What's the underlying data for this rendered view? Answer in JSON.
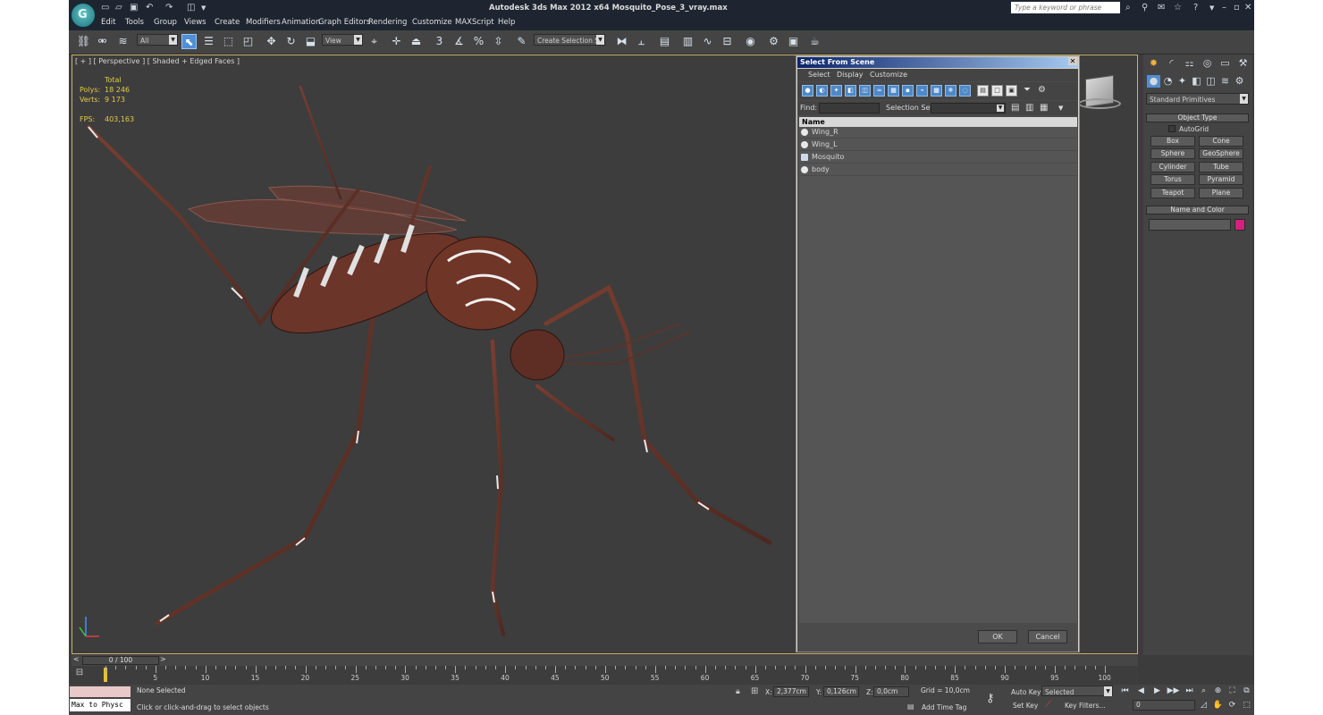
{
  "window": {
    "title": "Autodesk 3ds Max  2012 x64     Mosquito_Pose_3_vray.max",
    "logo_letter": "G",
    "search_placeholder": "Type a keyword or phrase"
  },
  "menu": [
    "Edit",
    "Tools",
    "Group",
    "Views",
    "Create",
    "Modifiers",
    "Animation",
    "Graph Editors",
    "Rendering",
    "Customize",
    "MAXScript",
    "Help"
  ],
  "toolbar": {
    "filter_combo": "All",
    "refcoord_combo": "View",
    "selection_set_combo": "Create Selection Se",
    "snap_label": "3",
    "percent_label": "%"
  },
  "viewport": {
    "label": "[ + ] [ Perspective ] [ Shaded + Edged Faces ]",
    "stats": {
      "header": "Total",
      "polys_label": "Polys:",
      "polys_value": "18 246",
      "verts_label": "Verts:",
      "verts_value": "9 173",
      "fps_label": "FPS:",
      "fps_value": "403,163"
    },
    "colors": {
      "body": "#6b3529",
      "leg_highlight": "#e8e8e8",
      "background": "#3d3d3d"
    }
  },
  "dialog": {
    "title": "Select From Scene",
    "menu": [
      "Select",
      "Display",
      "Customize"
    ],
    "find_label": "Find:",
    "selection_set_label": "Selection Set:",
    "column_name": "Name",
    "items": [
      {
        "name": "Wing_R",
        "icon": "sphere-icon"
      },
      {
        "name": "Wing_L",
        "icon": "sphere-icon"
      },
      {
        "name": "Mosquito",
        "icon": "group-icon"
      },
      {
        "name": "body",
        "icon": "sphere-icon"
      }
    ],
    "ok_label": "OK",
    "cancel_label": "Cancel"
  },
  "command_panel": {
    "category_combo": "Standard Primitives",
    "object_type_header": "Object Type",
    "autogrid_label": "AutoGrid",
    "buttons": [
      "Box",
      "Cone",
      "Sphere",
      "GeoSphere",
      "Cylinder",
      "Tube",
      "Torus",
      "Pyramid",
      "Teapot",
      "Plane"
    ],
    "name_color_header": "Name and Color",
    "swatch_color": "#d2227e"
  },
  "timeline": {
    "frame_label": "0 / 100",
    "ticks": [
      "0",
      "5",
      "10",
      "15",
      "20",
      "25",
      "30",
      "35",
      "40",
      "45",
      "50",
      "55",
      "60",
      "65",
      "70",
      "75",
      "80",
      "85",
      "90",
      "95",
      "100"
    ]
  },
  "status": {
    "maxscript_label": "Max to Physc",
    "selection_text": "None Selected",
    "prompt_text": "Click or click-and-drag to select objects",
    "x_label": "X:",
    "x_value": "2,377cm",
    "y_label": "Y:",
    "y_value": "0,126cm",
    "z_label": "Z:",
    "z_value": "0,0cm",
    "grid_text": "Grid = 10,0cm",
    "add_time_tag": "Add Time Tag",
    "auto_key": "Auto Key",
    "set_key": "Set Key",
    "selected_combo": "Selected",
    "key_filters": "Key Filters...",
    "frame_field": "0"
  }
}
